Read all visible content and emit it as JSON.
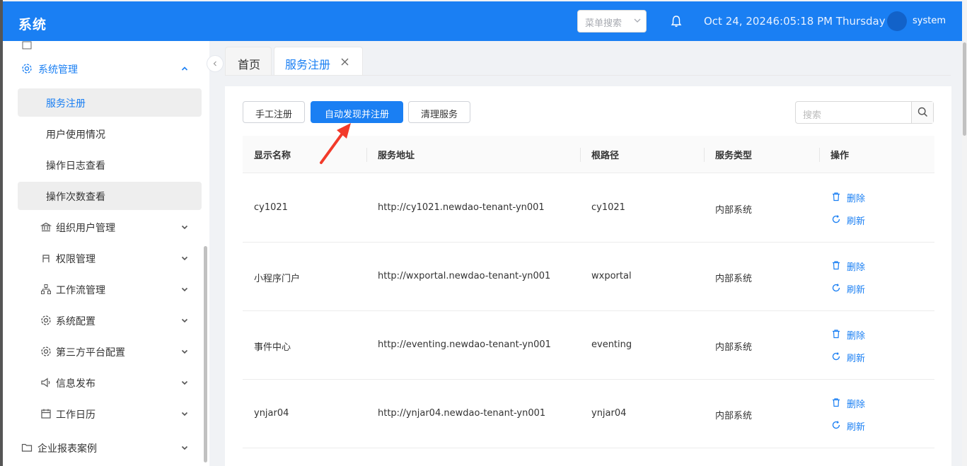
{
  "header": {
    "title": "系统",
    "menu_search_placeholder": "菜单搜索",
    "datetime": "Oct 24, 20246:05:18 PM Thursday",
    "username": "system"
  },
  "sidebar": {
    "group": "系统管理",
    "items": [
      {
        "label": "服务注册"
      },
      {
        "label": "用户使用情况"
      },
      {
        "label": "操作日志查看"
      },
      {
        "label": "操作次数查看"
      },
      {
        "label": "组织用户管理"
      },
      {
        "label": "权限管理"
      },
      {
        "label": "工作流管理"
      },
      {
        "label": "系统配置"
      },
      {
        "label": "第三方平台配置"
      },
      {
        "label": "信息发布"
      },
      {
        "label": "工作日历"
      },
      {
        "label": "企业报表案例"
      }
    ]
  },
  "tabs": [
    {
      "label": "首页"
    },
    {
      "label": "服务注册"
    }
  ],
  "toolbar": {
    "manual_label": "手工注册",
    "auto_label": "自动发现并注册",
    "clean_label": "清理服务",
    "search_placeholder": "搜索"
  },
  "table": {
    "columns": [
      "显示名称",
      "服务地址",
      "根路径",
      "服务类型",
      "操作"
    ],
    "rows": [
      {
        "name": "cy1021",
        "url": "http://cy1021.newdao-tenant-yn001",
        "root": "cy1021",
        "type": "内部系统"
      },
      {
        "name": "小程序门户",
        "url": "http://wxportal.newdao-tenant-yn001",
        "root": "wxportal",
        "type": "内部系统"
      },
      {
        "name": "事件中心",
        "url": "http://eventing.newdao-tenant-yn001",
        "root": "eventing",
        "type": "内部系统"
      },
      {
        "name": "ynjar04",
        "url": "http://ynjar04.newdao-tenant-yn001",
        "root": "ynjar04",
        "type": "内部系统"
      }
    ],
    "delete_label": "删除",
    "refresh_label": "刷新"
  }
}
